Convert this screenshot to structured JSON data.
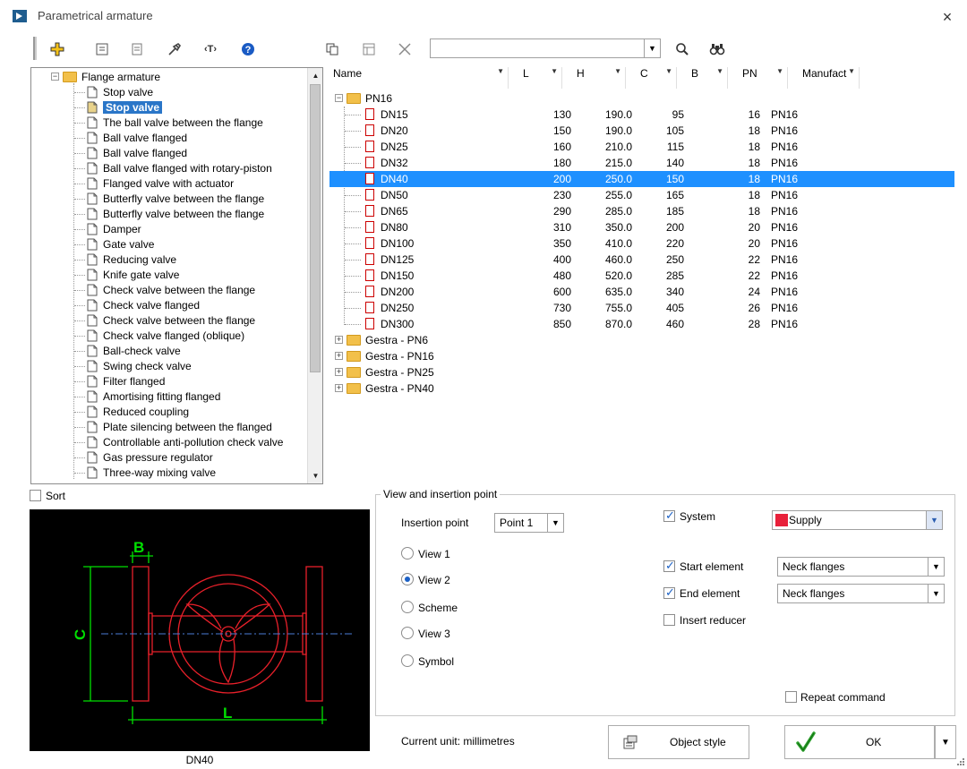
{
  "window": {
    "title": "Parametrical armature",
    "close_glyph": "×"
  },
  "toolbar": {
    "search": {
      "value": "",
      "placeholder": ""
    },
    "icons": [
      "add-icon",
      "properties-icon",
      "list-icon",
      "tools-icon",
      "text-icon",
      "help-icon",
      "copy-icon",
      "table-icon",
      "delete-icon",
      "search-icon",
      "find-icon"
    ]
  },
  "tree": {
    "root": "Flange armature",
    "items": [
      "Stop valve",
      "Stop valve",
      "The ball valve between the flange",
      "Ball valve flanged",
      "Ball valve flanged",
      "Ball valve flanged with rotary-piston",
      "Flanged valve with actuator",
      "Butterfly valve between the flange",
      "Butterfly valve between the flange",
      "Damper",
      "Gate valve",
      "Reducing valve",
      "Knife gate valve",
      "Check valve between the flange",
      "Check valve flanged",
      "Check valve between the flange",
      "Check valve flanged (oblique)",
      "Ball-check valve",
      "Swing check valve",
      "Filter flanged",
      "Amortising fitting flanged",
      "Reduced coupling",
      "Plate silencing between the flanged",
      "Controllable anti-pollution check valve",
      "Gas pressure regulator",
      "Three-way mixing valve"
    ],
    "selected_index": 1
  },
  "table": {
    "columns": [
      "Name",
      "L",
      "H",
      "C",
      "B",
      "PN",
      "Manufact"
    ],
    "group": "PN16",
    "rows": [
      [
        "DN15",
        "130",
        "190.0",
        "95",
        "16",
        "PN16"
      ],
      [
        "DN20",
        "150",
        "190.0",
        "105",
        "18",
        "PN16"
      ],
      [
        "DN25",
        "160",
        "210.0",
        "115",
        "18",
        "PN16"
      ],
      [
        "DN32",
        "180",
        "215.0",
        "140",
        "18",
        "PN16"
      ],
      [
        "DN40",
        "200",
        "250.0",
        "150",
        "18",
        "PN16"
      ],
      [
        "DN50",
        "230",
        "255.0",
        "165",
        "18",
        "PN16"
      ],
      [
        "DN65",
        "290",
        "285.0",
        "185",
        "18",
        "PN16"
      ],
      [
        "DN80",
        "310",
        "350.0",
        "200",
        "20",
        "PN16"
      ],
      [
        "DN100",
        "350",
        "410.0",
        "220",
        "20",
        "PN16"
      ],
      [
        "DN125",
        "400",
        "460.0",
        "250",
        "22",
        "PN16"
      ],
      [
        "DN150",
        "480",
        "520.0",
        "285",
        "22",
        "PN16"
      ],
      [
        "DN200",
        "600",
        "635.0",
        "340",
        "24",
        "PN16"
      ],
      [
        "DN250",
        "730",
        "755.0",
        "405",
        "26",
        "PN16"
      ],
      [
        "DN300",
        "850",
        "870.0",
        "460",
        "28",
        "PN16"
      ]
    ],
    "selected_row": 4,
    "other_groups": [
      "Gestra - PN6",
      "Gestra - PN16",
      "Gestra - PN25",
      "Gestra - PN40"
    ]
  },
  "sort": {
    "label": "Sort",
    "checked": false
  },
  "preview": {
    "label": "DN40",
    "dim_labels": {
      "b": "B",
      "c": "C",
      "l": "L"
    },
    "colors": {
      "outline": "#e8202a",
      "dims": "#00e000",
      "axis": "#4a7bd6"
    }
  },
  "options": {
    "group_title": "View and insertion point",
    "insertion_label": "Insertion point",
    "insertion_value": "Point 1",
    "views": [
      "View 1",
      "View 2",
      "Scheme",
      "View 3",
      "Symbol"
    ],
    "selected_view": 1,
    "system_label": "System",
    "system_value": "Supply",
    "system_color": "#e8203a",
    "start_label": "Start element",
    "start_value": "Neck flanges",
    "end_label": "End element",
    "end_value": "Neck flanges",
    "reducer_label": "Insert reducer",
    "repeat_label": "Repeat command"
  },
  "footer": {
    "unit_text": "Current unit: millimetres",
    "object_style": "Object style",
    "ok": "OK"
  }
}
